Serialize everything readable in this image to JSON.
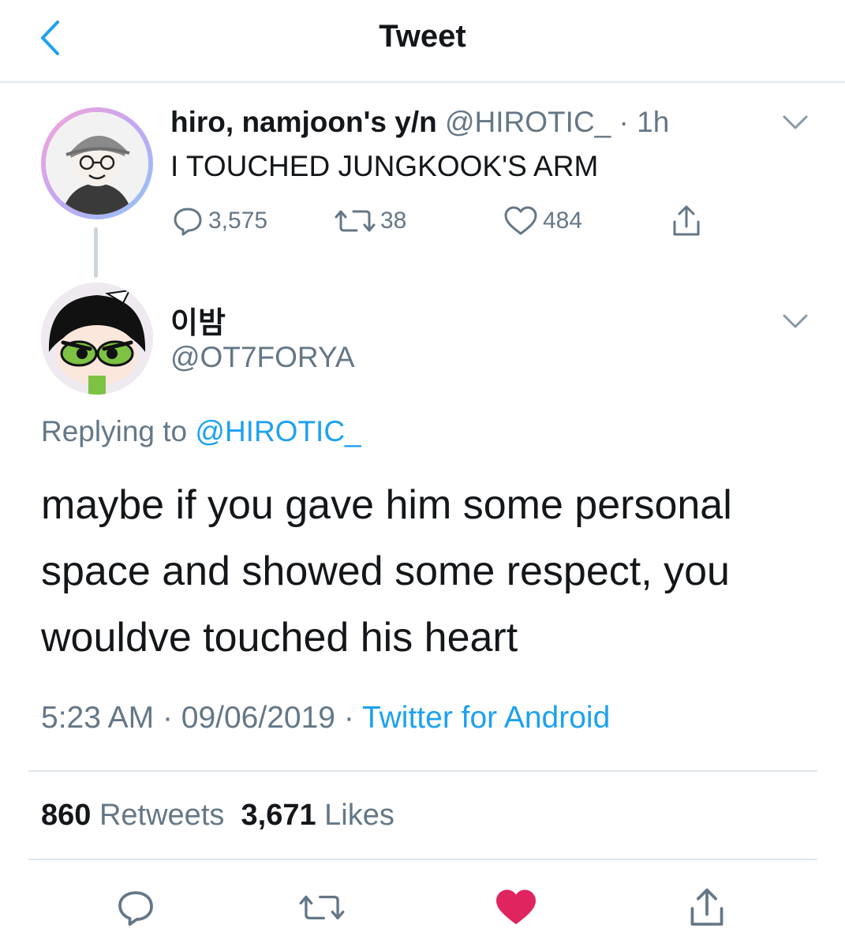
{
  "nav": {
    "title": "Tweet"
  },
  "parent_tweet": {
    "display_name": "hiro, namjoon's y/n",
    "handle": "@HIROTIC_",
    "separator": "·",
    "time": "1h",
    "text": "I TOUCHED JUNGKOOK'S ARM",
    "replies": "3,575",
    "retweets": "38",
    "likes": "484"
  },
  "reply_tweet": {
    "display_name": "이밤",
    "handle": "@OT7FORYA",
    "replying_prefix": "Replying to",
    "replying_to": "@HIROTIC_",
    "text": "maybe if you gave him some personal space and showed some respect, you wouldve touched his heart",
    "time": "5:23 AM",
    "date": "09/06/2019",
    "source": "Twitter for Android",
    "retweet_count": "860",
    "retweet_label": "Retweets",
    "like_count": "3,671",
    "like_label": "Likes"
  },
  "icons": {
    "back": "chevron-left-icon",
    "caret": "chevron-down-icon",
    "reply": "speech-bubble-icon",
    "retweet": "retweet-arrows-icon",
    "like": "heart-icon",
    "share": "share-upload-icon"
  },
  "colors": {
    "accent": "#1da1f2",
    "text": "#14171a",
    "muted": "#657786",
    "liked": "#e0245e"
  }
}
